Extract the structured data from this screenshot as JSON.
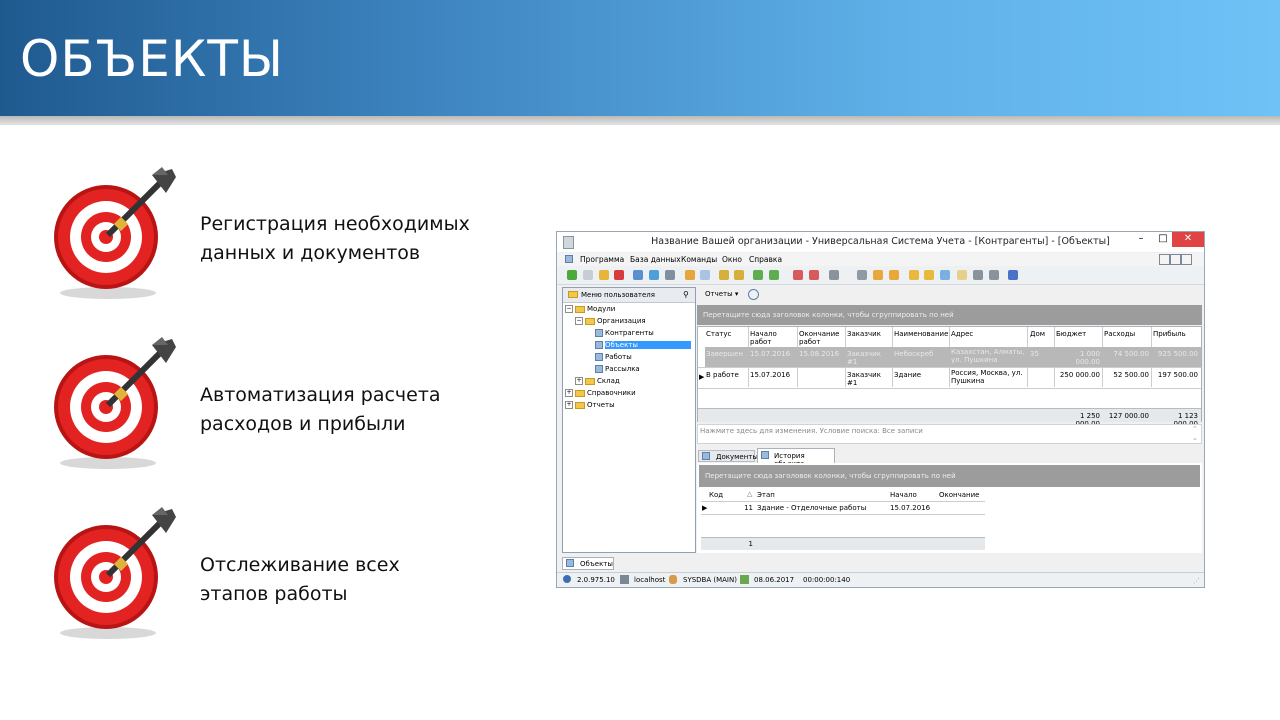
{
  "slide": {
    "title": "ОБЪЕКТЫ",
    "bullets": [
      {
        "line1": "Регистрация необходимых",
        "line2": "данных и документов"
      },
      {
        "line1": "Автоматизация расчета",
        "line2": "расходов и прибыли"
      },
      {
        "line1": "Отслеживание всех",
        "line2": "этапов работы"
      }
    ]
  },
  "window": {
    "title": "Название Вашей организации - Универсальная Система Учета - [Контрагенты] - [Объекты]",
    "menu": [
      "Программа",
      "База данных",
      "Команды",
      "Окно",
      "Справка"
    ],
    "left_panel": {
      "header": "Меню пользователя",
      "tree": [
        "Модули",
        "Организация",
        "Контрагенты",
        "Объекты",
        "Работы",
        "Рассылка",
        "Склад",
        "Справочники",
        "Отчеты"
      ]
    },
    "reports_button": "Отчеты",
    "group_hint": "Перетащите сюда заголовок колонки, чтобы сгруппировать по ней",
    "main_grid": {
      "headers": [
        "Статус",
        "Начало работ",
        "Окончание работ",
        "Заказчик",
        "Наименование",
        "Адрес",
        "Дом",
        "Бюджет",
        "Расходы",
        "Прибыль"
      ],
      "rows": [
        [
          "Завершен",
          "15.07.2016",
          "15.08.2016",
          "Заказчик #1",
          "Небоскреб",
          "Казахстан, Алматы, ул. Пушкина",
          "35",
          "1 000 000.00",
          "74 500.00",
          "925 500.00"
        ],
        [
          "В работе",
          "15.07.2016",
          "",
          "Заказчик #1",
          "Здание",
          "Россия, Москва, ул. Пушкина",
          "",
          "250 000.00",
          "52 500.00",
          "197 500.00"
        ]
      ],
      "totals": [
        "1 250 000.00",
        "127 000.00",
        "1 123 000.00"
      ]
    },
    "filter_hint": "Нажмите здесь для изменения. Условие поиска: Все записи",
    "tabs": [
      "Документы",
      "История объекта"
    ],
    "history_grid": {
      "headers": [
        "Код",
        "Этап",
        "Начало",
        "Окончание"
      ],
      "rows": [
        [
          "11",
          "Здание - Отделочные работы",
          "15.07.2016",
          ""
        ]
      ],
      "count": "1"
    },
    "bottom_tab": "Объекты",
    "status": [
      "2.0.975.10",
      "localhost",
      "SYSDBA (MAIN)",
      "08.06.2017",
      "00:00:00:140"
    ]
  }
}
